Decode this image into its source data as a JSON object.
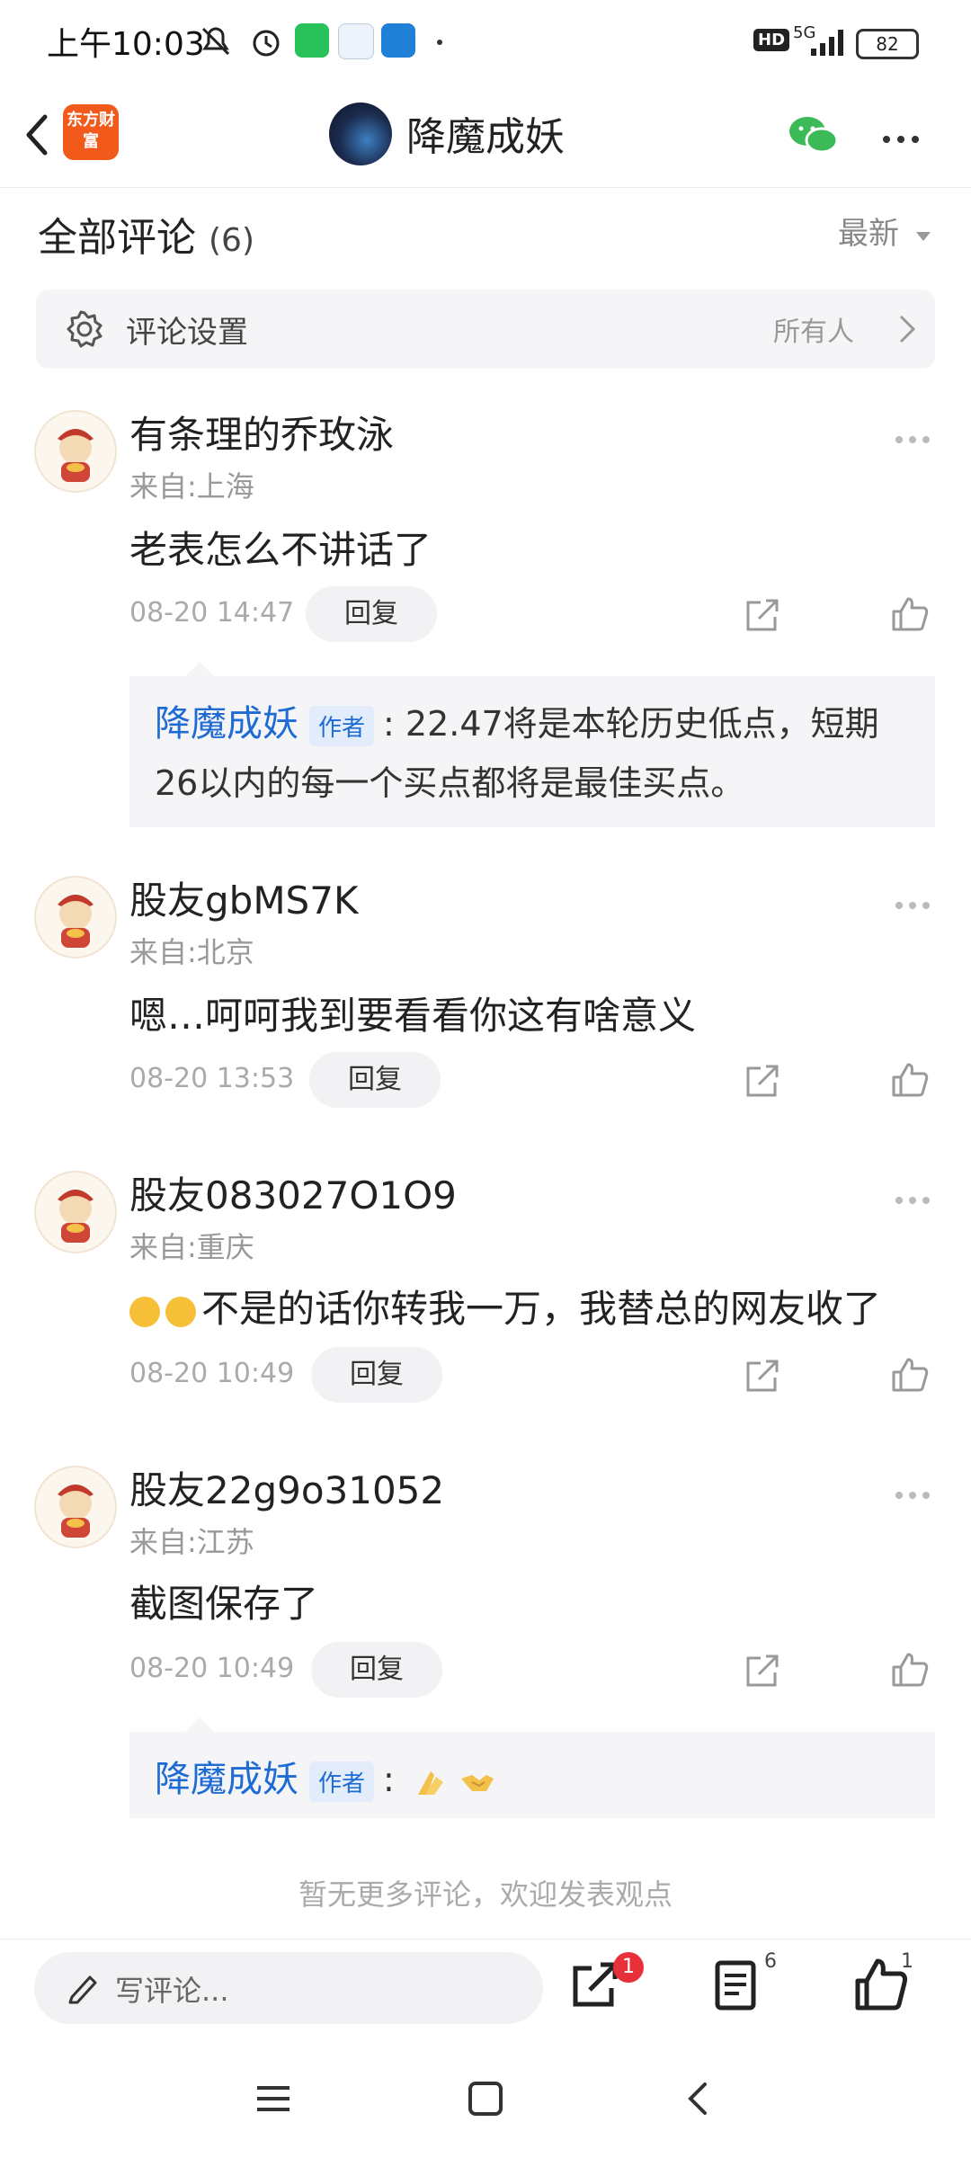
{
  "status_bar": {
    "time": "上午10:03",
    "network": "5G",
    "hd": "HD",
    "battery": "82"
  },
  "header": {
    "brand_logo_text": "东方财富",
    "title": "降魔成妖"
  },
  "comments_header": {
    "title": "全部评论",
    "count": "(6)",
    "sort": "最新"
  },
  "settings": {
    "label": "评论设置",
    "value": "所有人"
  },
  "comments": [
    {
      "name": "有条理的乔玫泳",
      "location": "来自:上海",
      "text": "老表怎么不讲话了",
      "time": "08-20 14:47",
      "reply_label": "回复",
      "sub_reply": {
        "name": "降魔成妖",
        "tag": "作者",
        "line1": ": 22.47将是本轮历史低点，短期",
        "line2": "26以内的每一个买点都将是最佳买点。"
      }
    },
    {
      "name": "股友gbMS7K",
      "location": "来自:北京",
      "text": "嗯…呵呵我到要看看你这有啥意义",
      "time": "08-20 13:53",
      "reply_label": "回复"
    },
    {
      "name": "股友083027O1O9",
      "location": "来自:重庆",
      "text": "不是的话你转我一万，我替总的网友收了",
      "time": "08-20 10:49",
      "reply_label": "回复"
    },
    {
      "name": "股友22g9o31052",
      "location": "来自:江苏",
      "text": "截图保存了",
      "time": "08-20 10:49",
      "reply_label": "回复",
      "sub_reply": {
        "name": "降魔成妖",
        "tag": "作者",
        "line1": ":"
      }
    }
  ],
  "end_text": "暂无更多评论，欢迎发表观点",
  "bottom_bar": {
    "placeholder": "写评论...",
    "share_badge": "1",
    "comment_count": "6",
    "like_count": "1"
  },
  "colors": {
    "accent_blue": "#1e6bd4",
    "brand_orange": "#f25a1b",
    "badge_red": "#e8303a"
  }
}
